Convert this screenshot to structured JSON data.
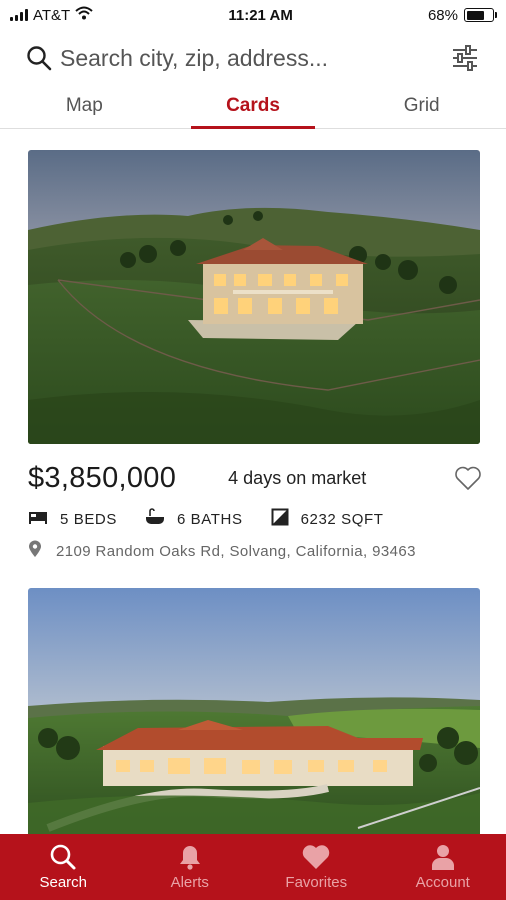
{
  "status_bar": {
    "carrier": "AT&T",
    "time": "11:21 AM",
    "battery": "68%",
    "battery_level": 0.68
  },
  "search": {
    "placeholder": "Search city, zip, address..."
  },
  "tabs": [
    {
      "label": "Map"
    },
    {
      "label": "Cards"
    },
    {
      "label": "Grid"
    }
  ],
  "listing": {
    "price": "$3,850,000",
    "days_on_market": "4 days on market",
    "beds": "5 BEDS",
    "baths": "6 BATHS",
    "sqft": "6232 SQFT",
    "address": "2109 Random Oaks Rd, Solvang, California, 93463"
  },
  "bottom_nav": [
    {
      "label": "Search",
      "icon": "search-icon"
    },
    {
      "label": "Alerts",
      "icon": "bell-icon"
    },
    {
      "label": "Favorites",
      "icon": "heart-icon"
    },
    {
      "label": "Account",
      "icon": "person-icon"
    }
  ],
  "colors": {
    "brand": "#b5121b",
    "nav_inactive": "#e9a2a6"
  }
}
